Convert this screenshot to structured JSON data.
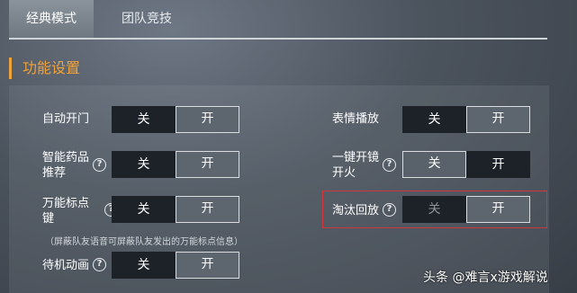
{
  "tabs": [
    {
      "label": "经典模式"
    },
    {
      "label": "团队竞技"
    }
  ],
  "section_title": "功能设置",
  "settings": {
    "auto_door": {
      "label": "自动开门",
      "off": "关",
      "on": "开"
    },
    "smart_medicine": {
      "label_line1": "智能药品",
      "label_line2": "推荐",
      "off": "关",
      "on": "开"
    },
    "universal_marker": {
      "label_line1": "万能标点",
      "label_line2": "键",
      "off": "关",
      "on": "开"
    },
    "universal_marker_note": "（屏蔽队友语音可屏蔽队友发出的万能标点信息）",
    "idle_animation": {
      "label": "待机动画",
      "off": "关",
      "on": "开"
    },
    "emote_playback": {
      "label": "表情播放",
      "off": "关",
      "on": "开"
    },
    "one_key_scope_fire": {
      "label_line1": "一键开镜",
      "label_line2": "开火",
      "off": "关",
      "on": "开"
    },
    "elimination_replay": {
      "label": "淘汰回放",
      "off": "关",
      "on": "开"
    }
  },
  "help_glyph": "?",
  "watermark": "头条 @难言x游戏解说",
  "colors": {
    "accent": "#f0a23b",
    "highlight": "#d0363c"
  }
}
